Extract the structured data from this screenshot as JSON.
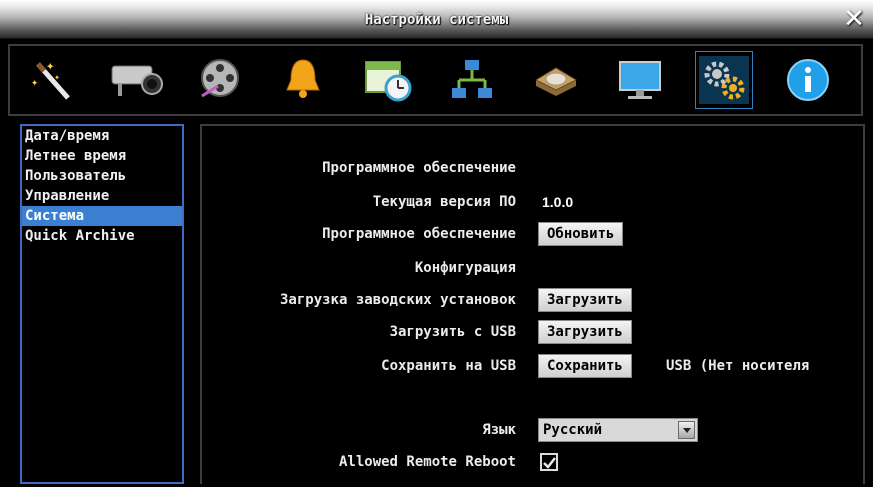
{
  "window": {
    "title": "Настройки системы",
    "close_glyph": "✕"
  },
  "toolbar": {
    "icons": [
      {
        "name": "magic-wand-icon"
      },
      {
        "name": "camera-icon"
      },
      {
        "name": "film-reel-icon"
      },
      {
        "name": "bell-icon"
      },
      {
        "name": "schedule-calendar-icon"
      },
      {
        "name": "network-icon"
      },
      {
        "name": "hard-disk-icon"
      },
      {
        "name": "monitor-icon"
      },
      {
        "name": "gears-icon",
        "active": true
      },
      {
        "name": "info-icon"
      }
    ]
  },
  "sidebar": {
    "items": [
      {
        "label": "Дата/время"
      },
      {
        "label": "Летнее время"
      },
      {
        "label": "Пользователь"
      },
      {
        "label": "Управление"
      },
      {
        "label": "Система",
        "selected": true
      },
      {
        "label": "Quick Archive"
      }
    ]
  },
  "system": {
    "software_heading": "Программное обеспечение",
    "current_version_label": "Текущая версия ПО",
    "current_version_value": "1.0.0",
    "firmware_label": "Программное обеспечение",
    "update_button": "Обновить",
    "config_heading": "Конфигурация",
    "factory_load_label": "Загрузка заводских установок",
    "factory_load_button": "Загрузить",
    "usb_load_label": "Загрузить с USB",
    "usb_load_button": "Загрузить",
    "usb_save_label": "Сохранить на USB",
    "usb_save_button": "Сохранить",
    "usb_status": "USB (Нет носителя",
    "language_label": "Язык",
    "language_value": "Русский",
    "remote_reboot_label": "Allowed Remote Reboot",
    "remote_reboot_checked": true
  }
}
